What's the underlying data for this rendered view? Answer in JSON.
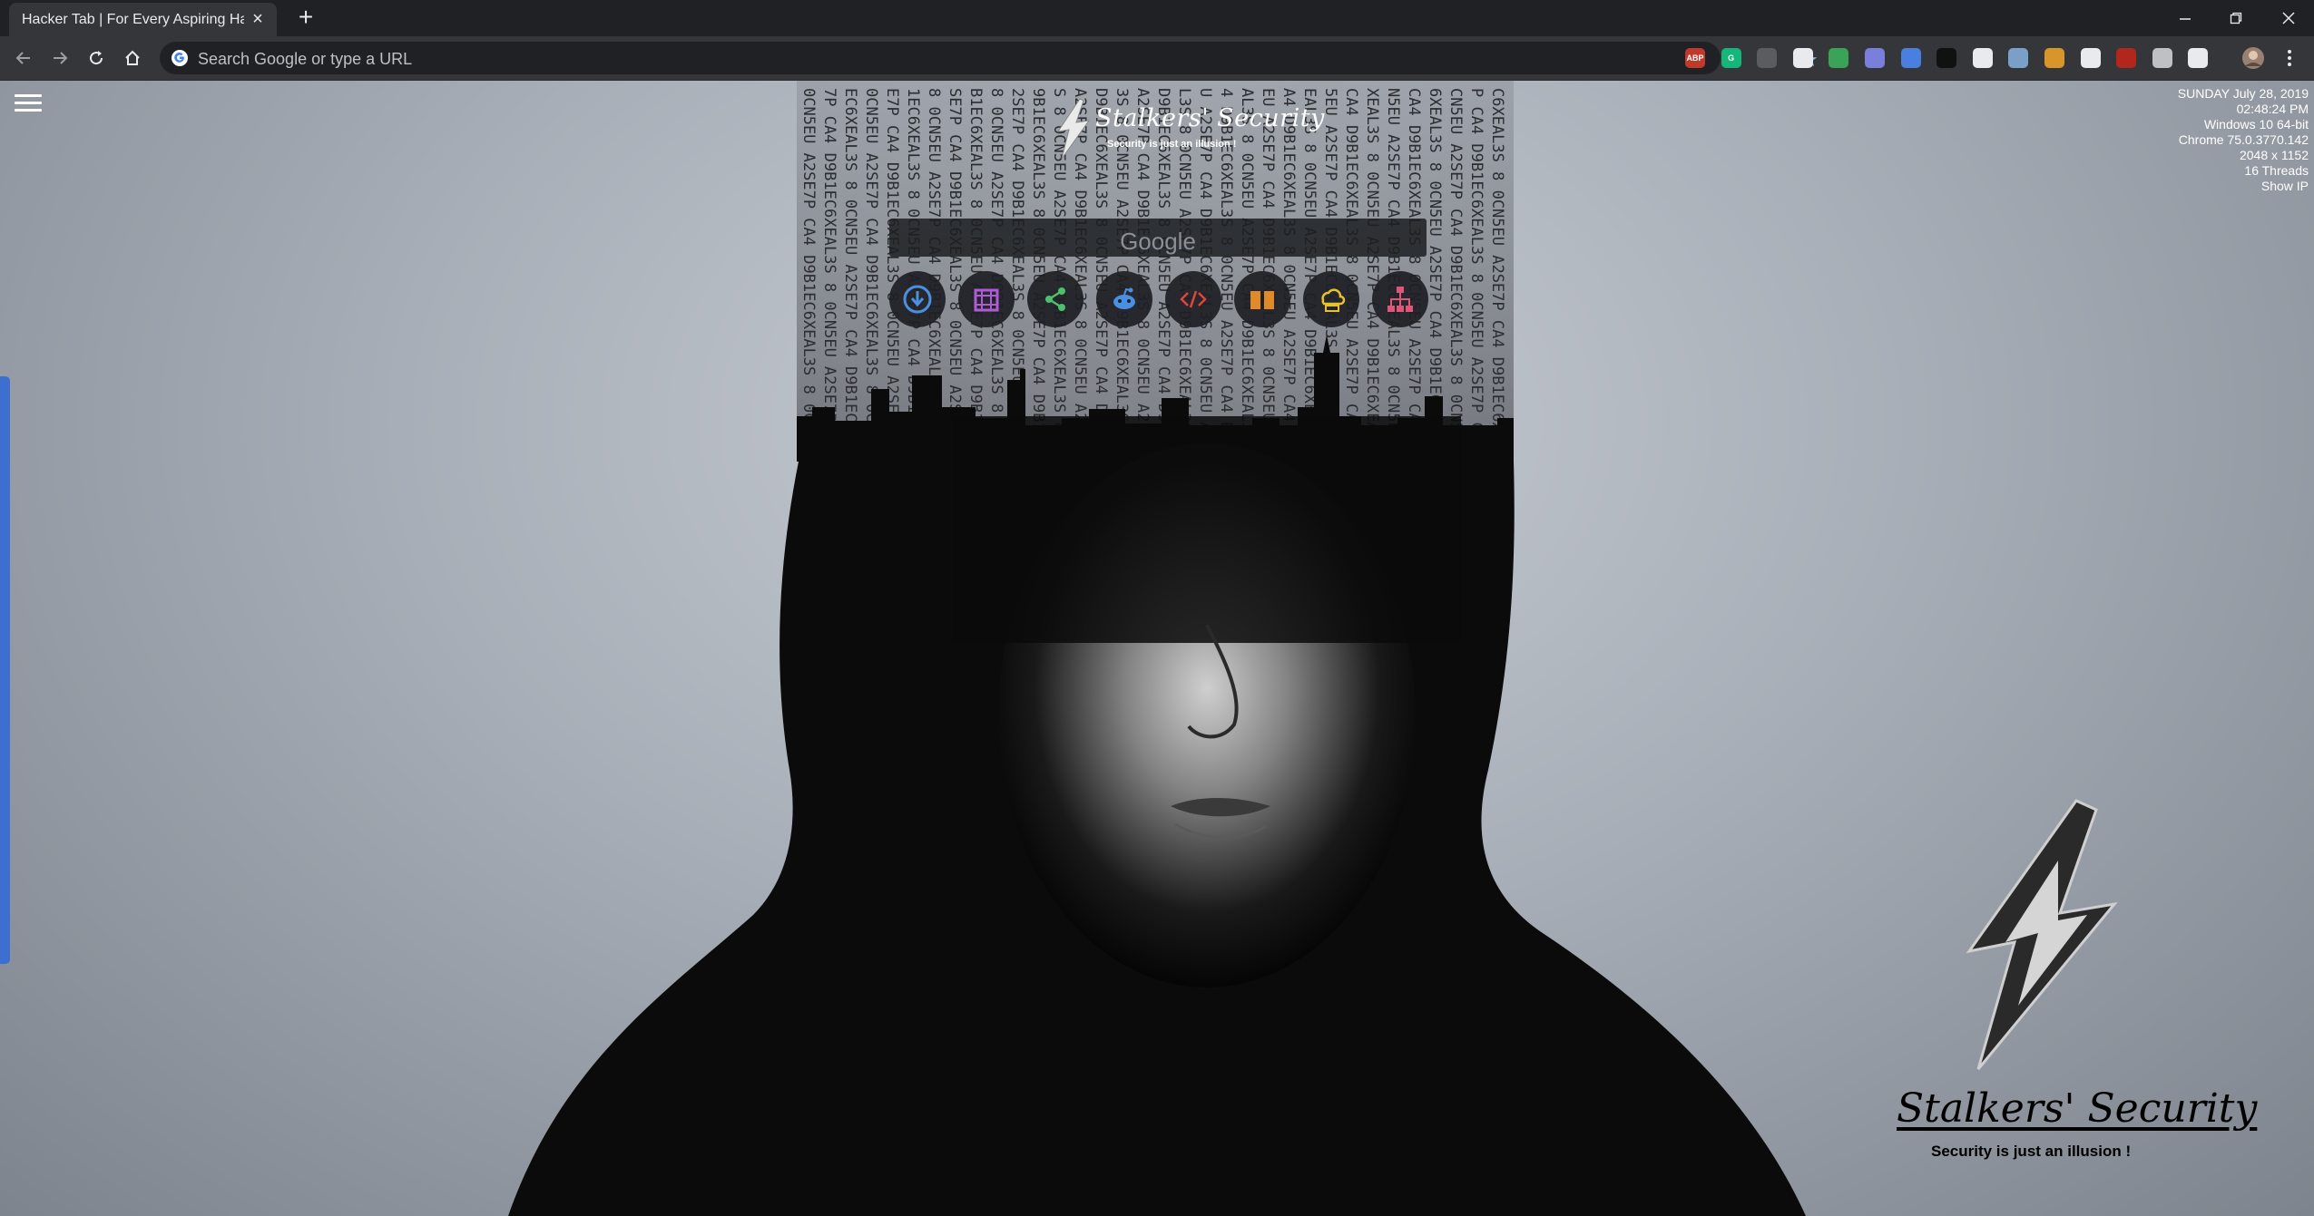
{
  "browser": {
    "tab_title": "Hacker Tab | For Every Aspiring Hacker",
    "tab_close": "×",
    "new_tab": "+",
    "omnibox_placeholder": "Search Google or type a URL",
    "extensions": [
      {
        "name": "adblock-plus-icon",
        "label": "ABP",
        "color": "#c0392b"
      },
      {
        "name": "grammarly-icon",
        "label": "G",
        "color": "#15b67c"
      },
      {
        "name": "mail-extension-icon",
        "label": "",
        "color": "#5a5c60"
      },
      {
        "name": "circle-extension-icon",
        "label": "",
        "color": "#e8eaed"
      },
      {
        "name": "color-extension-icon",
        "label": "",
        "color": "#3aa357"
      },
      {
        "name": "block-extension-icon",
        "label": "",
        "color": "#7a7fdb"
      },
      {
        "name": "translate-icon",
        "label": "",
        "color": "#4a7fe0"
      },
      {
        "name": "drop-extension-icon",
        "label": "",
        "color": "#111111"
      },
      {
        "name": "speed-extension-icon",
        "label": "",
        "color": "#e8eaed"
      },
      {
        "name": "cookie-extension-icon",
        "label": "",
        "color": "#7aa0c8"
      },
      {
        "name": "puzzle-extension-icon",
        "label": "",
        "color": "#d8962a"
      },
      {
        "name": "grid-extension-icon",
        "label": "",
        "color": "#e8eaed"
      },
      {
        "name": "red-extension-icon",
        "label": "",
        "color": "#b3261e"
      },
      {
        "name": "camera-extension-icon",
        "label": "",
        "color": "#bdc1c6"
      },
      {
        "name": "battery-extension-icon",
        "label": "",
        "color": "#e8eaed"
      }
    ]
  },
  "page": {
    "sysinfo": [
      "SUNDAY July 28, 2019",
      "02:48:24 PM",
      "Windows 10 64-bit",
      "Chrome 75.0.3770.142",
      "2048 x 1152",
      "16 Threads",
      "Show IP"
    ],
    "logo_title": "Stalkers' Security",
    "logo_subtitle": "Security is just an illusion !",
    "search_placeholder": "Google",
    "shortcuts": [
      {
        "name": "download-shortcut",
        "icon": "download-icon",
        "color": "#4a90e2"
      },
      {
        "name": "movies-shortcut",
        "icon": "film-icon",
        "color": "#b05bd6"
      },
      {
        "name": "share-shortcut",
        "icon": "share-icon",
        "color": "#4cc06b"
      },
      {
        "name": "reddit-shortcut",
        "icon": "reddit-icon",
        "color": "#4a90e2"
      },
      {
        "name": "code-shortcut",
        "icon": "code-icon",
        "color": "#e0453a"
      },
      {
        "name": "book-shortcut",
        "icon": "book-icon",
        "color": "#e08a2a"
      },
      {
        "name": "cloud-storage-shortcut",
        "icon": "cloud-drive-icon",
        "color": "#e8c22a"
      },
      {
        "name": "sitemap-shortcut",
        "icon": "sitemap-icon",
        "color": "#e0567a"
      }
    ],
    "accent_color": "#3d6fd1"
  }
}
